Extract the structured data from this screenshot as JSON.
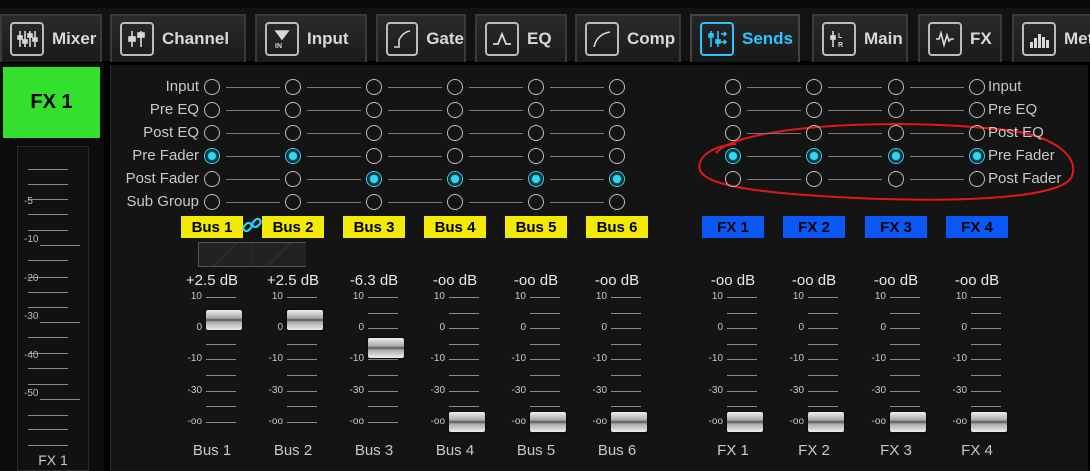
{
  "tabs": [
    {
      "label": "Mixer",
      "icon": "mixer-icon",
      "active": false
    },
    {
      "label": "Channel",
      "icon": "channel-icon",
      "active": false
    },
    {
      "label": "Input",
      "icon": "input-icon",
      "active": false
    },
    {
      "label": "Gate",
      "icon": "gate-icon",
      "active": false
    },
    {
      "label": "EQ",
      "icon": "eq-icon",
      "active": false
    },
    {
      "label": "Comp",
      "icon": "comp-icon",
      "active": false
    },
    {
      "label": "Sends",
      "icon": "sends-icon",
      "active": true
    },
    {
      "label": "Main",
      "icon": "main-icon",
      "active": false
    },
    {
      "label": "FX",
      "icon": "fx-icon",
      "active": false
    },
    {
      "label": "Met",
      "icon": "meter-icon",
      "active": false
    }
  ],
  "channel": {
    "name": "FX 1",
    "footer": "FX 1"
  },
  "left_fader_scale": [
    "-5",
    "-10",
    "-20",
    "-30",
    "-40",
    "-50"
  ],
  "tap_rows": [
    "Input",
    "Pre EQ",
    "Post EQ",
    "Pre Fader",
    "Post Fader",
    "Sub Group"
  ],
  "fx_tap_rows": [
    "Input",
    "Pre EQ",
    "Post EQ",
    "Pre Fader",
    "Post Fader"
  ],
  "bus_sends": [
    {
      "name": "Bus 1",
      "level": "+2.5 dB",
      "tap": "Pre Fader",
      "fader_db": 2.5
    },
    {
      "name": "Bus 2",
      "level": "+2.5 dB",
      "tap": "Pre Fader",
      "fader_db": 2.5
    },
    {
      "name": "Bus 3",
      "level": "-6.3 dB",
      "tap": "Post Fader",
      "fader_db": -6.3
    },
    {
      "name": "Bus 4",
      "level": "-oo dB",
      "tap": "Post Fader",
      "fader_db": null
    },
    {
      "name": "Bus 5",
      "level": "-oo dB",
      "tap": "Post Fader",
      "fader_db": null
    },
    {
      "name": "Bus 6",
      "level": "-oo dB",
      "tap": "Post Fader",
      "fader_db": null
    }
  ],
  "fx_sends": [
    {
      "name": "FX 1",
      "level": "-oo dB",
      "tap": "Pre Fader",
      "fader_db": null
    },
    {
      "name": "FX 2",
      "level": "-oo dB",
      "tap": "Pre Fader",
      "fader_db": null
    },
    {
      "name": "FX 3",
      "level": "-oo dB",
      "tap": "Pre Fader",
      "fader_db": null
    },
    {
      "name": "FX 4",
      "level": "-oo dB",
      "tap": "Pre Fader",
      "fader_db": null
    }
  ],
  "fader_scale": [
    "10",
    "0",
    "-10",
    "-30",
    "-oo"
  ],
  "colors": {
    "bus_badge": "#f2ea00",
    "fx_badge": "#0a58f6",
    "active_tab": "#27c8ff",
    "selected_radio": "#29d9f5",
    "channel_badge": "#33e02e",
    "annotation": "#e01818"
  }
}
